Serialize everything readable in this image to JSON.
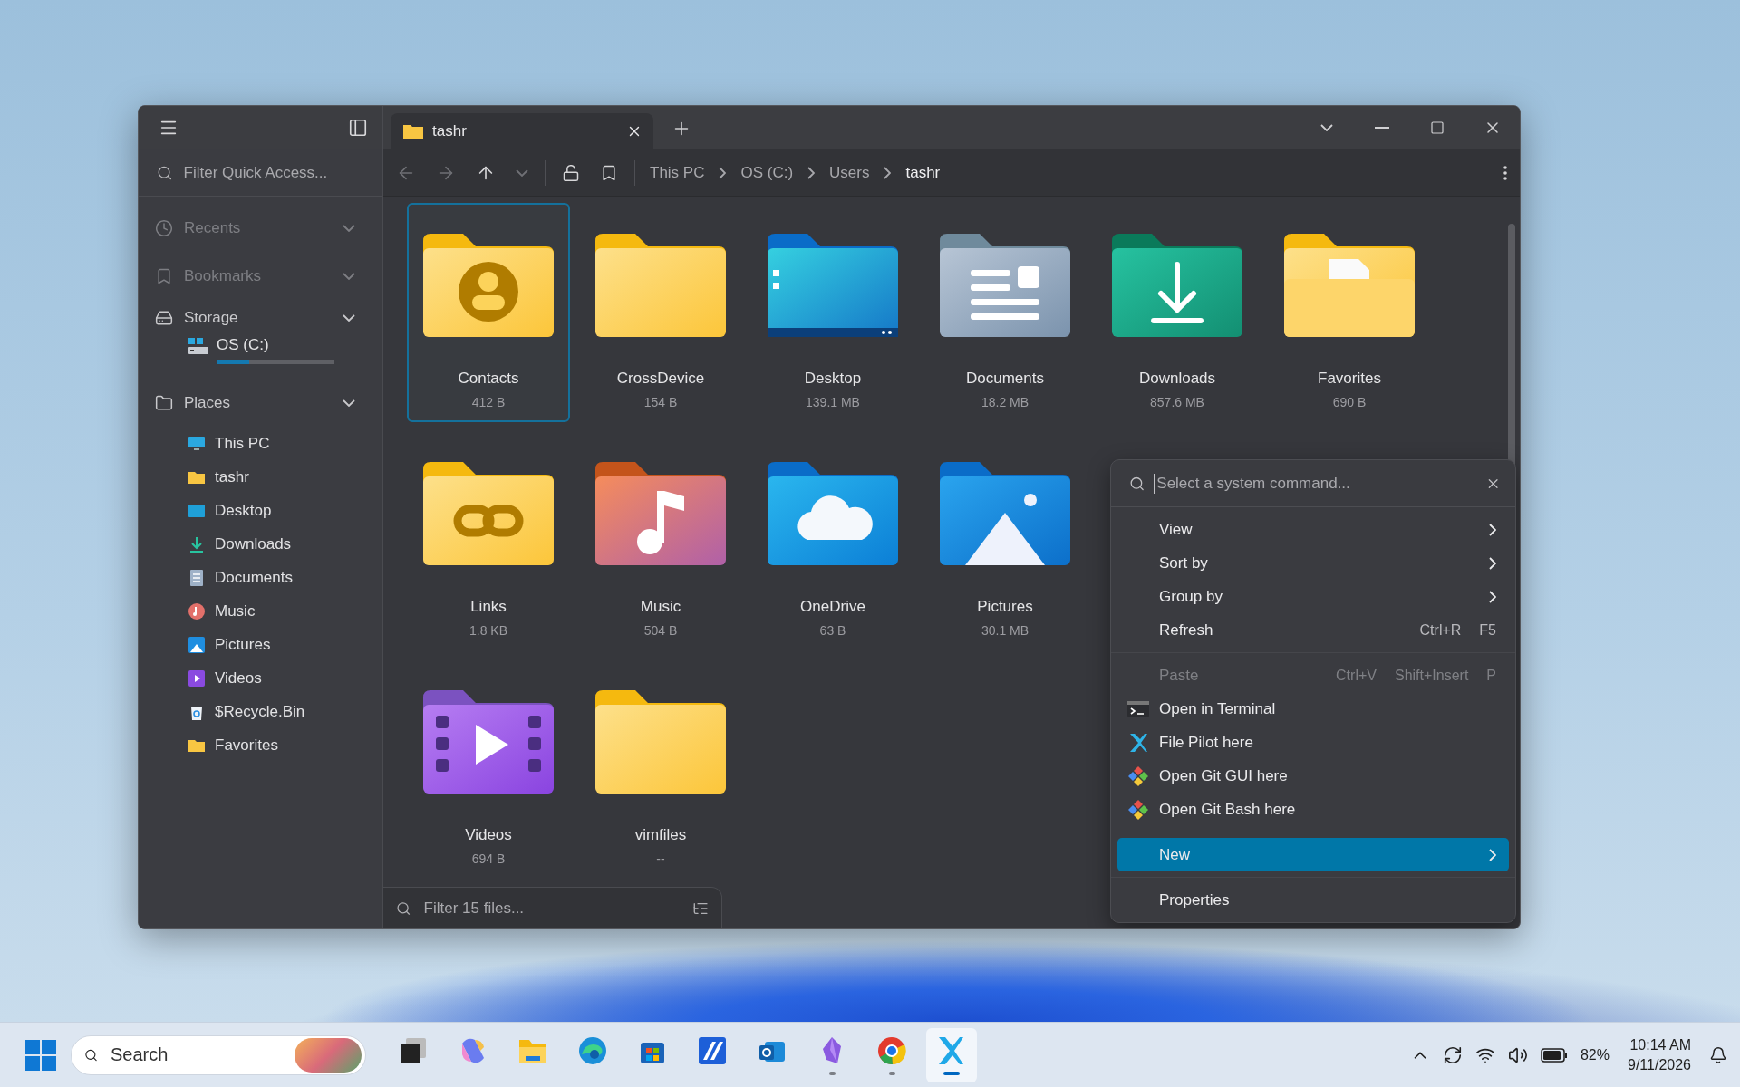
{
  "sidebar": {
    "filter_placeholder": "Filter Quick Access...",
    "sections": [
      {
        "title": "Recents",
        "kind": "recents",
        "disabled": true
      },
      {
        "title": "Bookmarks",
        "kind": "bookmarks",
        "disabled": true
      },
      {
        "title": "Storage",
        "kind": "storage",
        "disabled": false,
        "drives": [
          {
            "name": "OS (C:)",
            "level": 0.28
          }
        ]
      },
      {
        "title": "Places",
        "kind": "places",
        "disabled": false,
        "items": [
          {
            "label": "This PC",
            "kind": "pc"
          },
          {
            "label": "tashr",
            "kind": "folder"
          },
          {
            "label": "Desktop",
            "kind": "desktop"
          },
          {
            "label": "Downloads",
            "kind": "download"
          },
          {
            "label": "Documents",
            "kind": "document"
          },
          {
            "label": "Music",
            "kind": "music"
          },
          {
            "label": "Pictures",
            "kind": "picture"
          },
          {
            "label": "Videos",
            "kind": "video"
          },
          {
            "label": "$Recycle.Bin",
            "kind": "recycle"
          },
          {
            "label": "Favorites",
            "kind": "folder"
          }
        ]
      }
    ]
  },
  "tabs": [
    {
      "label": "tashr",
      "selected": true
    }
  ],
  "toolbar": {
    "nav_buttons": [
      {
        "kind": "back",
        "disabled": true
      },
      {
        "kind": "forward",
        "disabled": true
      },
      {
        "kind": "up",
        "disabled": false
      },
      {
        "kind": "history",
        "disabled": true
      }
    ],
    "breadcrumb": [
      {
        "label": "This PC",
        "current": false
      },
      {
        "label": "OS (C:)",
        "current": false
      },
      {
        "label": "Users",
        "current": false
      },
      {
        "label": "tashr",
        "current": true
      }
    ]
  },
  "file_rows": [
    [
      {
        "name": "Contacts",
        "size": "412 B",
        "kind": "contacts",
        "selected": true
      },
      {
        "name": "CrossDevice",
        "size": "154 B",
        "kind": "plain",
        "selected": false
      },
      {
        "name": "Desktop",
        "size": "139.1 MB",
        "kind": "desktop",
        "selected": false
      },
      {
        "name": "Documents",
        "size": "18.2 MB",
        "kind": "documents",
        "selected": false
      },
      {
        "name": "Downloads",
        "size": "857.6 MB",
        "kind": "downloads",
        "selected": false
      },
      {
        "name": "Favorites",
        "size": "690 B",
        "kind": "favorites",
        "selected": false
      }
    ],
    [
      {
        "name": "Links",
        "size": "1.8 KB",
        "kind": "links",
        "selected": false
      },
      {
        "name": "Music",
        "size": "504 B",
        "kind": "music",
        "selected": false
      },
      {
        "name": "OneDrive",
        "size": "63 B",
        "kind": "onedrive",
        "selected": false
      },
      {
        "name": "Pictures",
        "size": "30.1 MB",
        "kind": "pictures",
        "selected": false
      }
    ],
    [
      {
        "name": "Videos",
        "size": "694 B",
        "kind": "videos",
        "selected": false
      },
      {
        "name": "vimfiles",
        "size": "--",
        "kind": "plain",
        "selected": false
      }
    ]
  ],
  "filter": {
    "placeholder": "Filter 15 files..."
  },
  "context_menu": {
    "placeholder": "Select a system command...",
    "groups": [
      [
        {
          "label": "View",
          "submenu": true,
          "disabled": false,
          "selected": false
        },
        {
          "label": "Sort by",
          "submenu": true,
          "disabled": false,
          "selected": false
        },
        {
          "label": "Group by",
          "submenu": true,
          "disabled": false,
          "selected": false
        },
        {
          "label": "Refresh",
          "submenu": false,
          "disabled": false,
          "selected": false,
          "shortcuts": [
            "Ctrl+R",
            "F5"
          ]
        }
      ],
      [
        {
          "label": "Paste",
          "submenu": false,
          "disabled": true,
          "selected": false,
          "shortcuts": [
            "Ctrl+V",
            "Shift+Insert",
            "P"
          ]
        },
        {
          "label": "Open in Terminal",
          "submenu": false,
          "disabled": false,
          "selected": false,
          "kind": "terminal"
        },
        {
          "label": "File Pilot here",
          "submenu": false,
          "disabled": false,
          "selected": false,
          "kind": "pilot"
        },
        {
          "label": "Open Git GUI here",
          "submenu": false,
          "disabled": false,
          "selected": false,
          "kind": "git"
        },
        {
          "label": "Open Git Bash here",
          "submenu": false,
          "disabled": false,
          "selected": false,
          "kind": "git"
        }
      ],
      [
        {
          "label": "New",
          "submenu": true,
          "disabled": false,
          "selected": true
        }
      ],
      [
        {
          "label": "Properties",
          "submenu": false,
          "disabled": false,
          "selected": false
        }
      ]
    ]
  },
  "taskbar": {
    "search_placeholder": "Search",
    "apps": [
      {
        "kind": "taskview",
        "running": false,
        "active": false
      },
      {
        "kind": "copilot",
        "running": false,
        "active": false
      },
      {
        "kind": "explorer",
        "running": false,
        "active": false
      },
      {
        "kind": "edge",
        "running": false,
        "active": false
      },
      {
        "kind": "store",
        "running": false,
        "active": false
      },
      {
        "kind": "stripes",
        "running": false,
        "active": false
      },
      {
        "kind": "outlook",
        "running": false,
        "active": false
      },
      {
        "kind": "gem",
        "running": true,
        "active": false
      },
      {
        "kind": "chrome",
        "running": true,
        "active": false
      },
      {
        "kind": "pilot",
        "running": true,
        "active": true
      }
    ],
    "battery": "82%",
    "time": "10:14 AM",
    "date": "9/11/2026"
  }
}
